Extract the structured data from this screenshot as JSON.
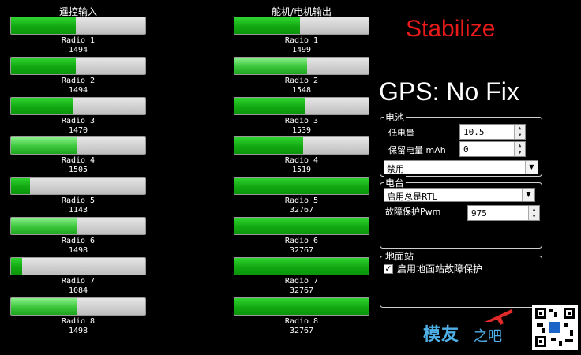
{
  "radio_in": {
    "title": "遥控输入",
    "items": [
      {
        "label": "Radio 1",
        "value": "1494",
        "level": 0.48
      },
      {
        "label": "Radio 2",
        "value": "1494",
        "level": 0.48
      },
      {
        "label": "Radio 3",
        "value": "1470",
        "level": 0.46
      },
      {
        "label": "Radio 4",
        "value": "1505",
        "level": 0.49
      },
      {
        "label": "Radio 5",
        "value": "1143",
        "level": 0.14
      },
      {
        "label": "Radio 6",
        "value": "1498",
        "level": 0.49
      },
      {
        "label": "Radio 7",
        "value": "1084",
        "level": 0.08
      },
      {
        "label": "Radio 8",
        "value": "1498",
        "level": 0.49
      }
    ]
  },
  "servo_out": {
    "title": "舵机/电机输出",
    "items": [
      {
        "label": "Radio 1",
        "value": "1499",
        "level": 0.49
      },
      {
        "label": "Radio 2",
        "value": "1548",
        "level": 0.54
      },
      {
        "label": "Radio 3",
        "value": "1539",
        "level": 0.53
      },
      {
        "label": "Radio 4",
        "value": "1519",
        "level": 0.51
      },
      {
        "label": "Radio 5",
        "value": "32767",
        "level": 1.0
      },
      {
        "label": "Radio 6",
        "value": "32767",
        "level": 1.0
      },
      {
        "label": "Radio 7",
        "value": "32767",
        "level": 1.0
      },
      {
        "label": "Radio 8",
        "value": "32767",
        "level": 1.0
      }
    ]
  },
  "status": {
    "mode": "Stabilize",
    "gps": "GPS: No Fix",
    "mode_color": "#e81a1a"
  },
  "battery": {
    "title": "电池",
    "low_label": "低电量",
    "low_value": "10.5",
    "reserve_label": "保留电量 mAh",
    "reserve_value": "0",
    "action_selected": "禁用"
  },
  "radio": {
    "title": "电台",
    "failsafe_selected": "启用总是RTL",
    "pwm_label": "故障保护Pwm",
    "pwm_value": "975"
  },
  "gcs": {
    "title": "地面站",
    "checkbox_label": "启用地面站故障保护",
    "checked": true
  },
  "watermark": {
    "brand": "模友",
    "suffix": "之吧"
  },
  "colors": {
    "bar_green": "#12a812",
    "background": "#000000",
    "logo_blue": "#4fb0e8"
  }
}
